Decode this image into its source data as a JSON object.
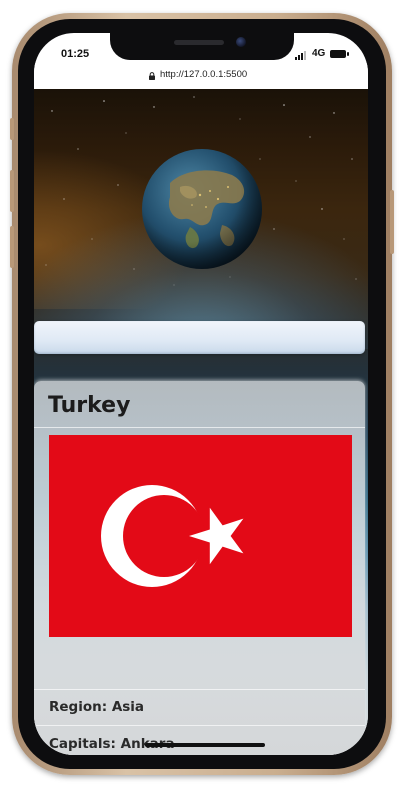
{
  "status_bar": {
    "time": "01:25",
    "network": "4G"
  },
  "browser": {
    "url": "http://127.0.0.1:5500"
  },
  "search": {
    "value": "",
    "placeholder": ""
  },
  "country": {
    "name": "Turkey",
    "flag_colors": {
      "red": "#e30a17",
      "white": "#ffffff"
    },
    "region_label": "Region: Asia",
    "capitals_label": "Capitals: Ankara"
  },
  "icons": {
    "lock": "lock-icon",
    "signal": "signal-icon",
    "battery": "battery-icon",
    "globe": "globe-icon"
  }
}
